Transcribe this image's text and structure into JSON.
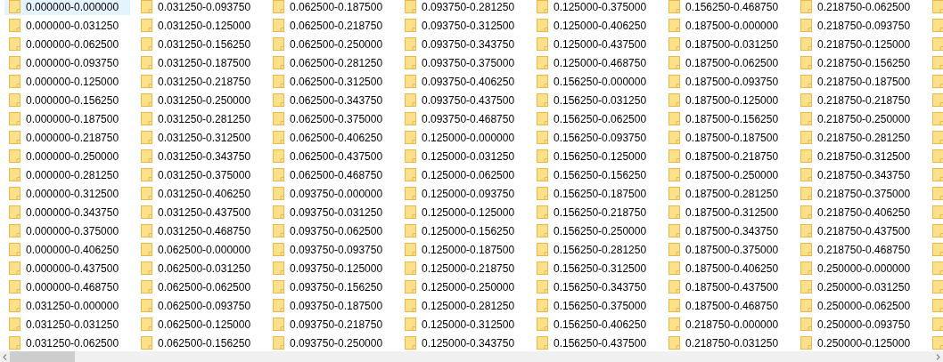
{
  "items": [
    {
      "name": "0.000000-0.000000",
      "selected": true
    },
    {
      "name": "0.000000-0.031250",
      "selected": false
    },
    {
      "name": "0.000000-0.062500",
      "selected": false
    },
    {
      "name": "0.000000-0.093750",
      "selected": false
    },
    {
      "name": "0.000000-0.125000",
      "selected": false
    },
    {
      "name": "0.000000-0.156250",
      "selected": false
    },
    {
      "name": "0.000000-0.187500",
      "selected": false
    },
    {
      "name": "0.000000-0.218750",
      "selected": false
    },
    {
      "name": "0.000000-0.250000",
      "selected": false
    },
    {
      "name": "0.000000-0.281250",
      "selected": false
    },
    {
      "name": "0.000000-0.312500",
      "selected": false
    },
    {
      "name": "0.000000-0.343750",
      "selected": false
    },
    {
      "name": "0.000000-0.375000",
      "selected": false
    },
    {
      "name": "0.000000-0.406250",
      "selected": false
    },
    {
      "name": "0.000000-0.437500",
      "selected": false
    },
    {
      "name": "0.000000-0.468750",
      "selected": false
    },
    {
      "name": "0.031250-0.000000",
      "selected": false
    },
    {
      "name": "0.031250-0.031250",
      "selected": false
    },
    {
      "name": "0.031250-0.062500",
      "selected": false
    },
    {
      "name": "0.031250-0.093750",
      "selected": false
    },
    {
      "name": "0.031250-0.125000",
      "selected": false
    },
    {
      "name": "0.031250-0.156250",
      "selected": false
    },
    {
      "name": "0.031250-0.187500",
      "selected": false
    },
    {
      "name": "0.031250-0.218750",
      "selected": false
    },
    {
      "name": "0.031250-0.250000",
      "selected": false
    },
    {
      "name": "0.031250-0.281250",
      "selected": false
    },
    {
      "name": "0.031250-0.312500",
      "selected": false
    },
    {
      "name": "0.031250-0.343750",
      "selected": false
    },
    {
      "name": "0.031250-0.375000",
      "selected": false
    },
    {
      "name": "0.031250-0.406250",
      "selected": false
    },
    {
      "name": "0.031250-0.437500",
      "selected": false
    },
    {
      "name": "0.031250-0.468750",
      "selected": false
    },
    {
      "name": "0.062500-0.000000",
      "selected": false
    },
    {
      "name": "0.062500-0.031250",
      "selected": false
    },
    {
      "name": "0.062500-0.062500",
      "selected": false
    },
    {
      "name": "0.062500-0.093750",
      "selected": false
    },
    {
      "name": "0.062500-0.125000",
      "selected": false
    },
    {
      "name": "0.062500-0.156250",
      "selected": false
    },
    {
      "name": "0.062500-0.187500",
      "selected": false
    },
    {
      "name": "0.062500-0.218750",
      "selected": false
    },
    {
      "name": "0.062500-0.250000",
      "selected": false
    },
    {
      "name": "0.062500-0.281250",
      "selected": false
    },
    {
      "name": "0.062500-0.312500",
      "selected": false
    },
    {
      "name": "0.062500-0.343750",
      "selected": false
    },
    {
      "name": "0.062500-0.375000",
      "selected": false
    },
    {
      "name": "0.062500-0.406250",
      "selected": false
    },
    {
      "name": "0.062500-0.437500",
      "selected": false
    },
    {
      "name": "0.062500-0.468750",
      "selected": false
    },
    {
      "name": "0.093750-0.000000",
      "selected": false
    },
    {
      "name": "0.093750-0.031250",
      "selected": false
    },
    {
      "name": "0.093750-0.062500",
      "selected": false
    },
    {
      "name": "0.093750-0.093750",
      "selected": false
    },
    {
      "name": "0.093750-0.125000",
      "selected": false
    },
    {
      "name": "0.093750-0.156250",
      "selected": false
    },
    {
      "name": "0.093750-0.187500",
      "selected": false
    },
    {
      "name": "0.093750-0.218750",
      "selected": false
    },
    {
      "name": "0.093750-0.250000",
      "selected": false
    },
    {
      "name": "0.093750-0.281250",
      "selected": false
    },
    {
      "name": "0.093750-0.312500",
      "selected": false
    },
    {
      "name": "0.093750-0.343750",
      "selected": false
    },
    {
      "name": "0.093750-0.375000",
      "selected": false
    },
    {
      "name": "0.093750-0.406250",
      "selected": false
    },
    {
      "name": "0.093750-0.437500",
      "selected": false
    },
    {
      "name": "0.093750-0.468750",
      "selected": false
    },
    {
      "name": "0.125000-0.000000",
      "selected": false
    },
    {
      "name": "0.125000-0.031250",
      "selected": false
    },
    {
      "name": "0.125000-0.062500",
      "selected": false
    },
    {
      "name": "0.125000-0.093750",
      "selected": false
    },
    {
      "name": "0.125000-0.125000",
      "selected": false
    },
    {
      "name": "0.125000-0.156250",
      "selected": false
    },
    {
      "name": "0.125000-0.187500",
      "selected": false
    },
    {
      "name": "0.125000-0.218750",
      "selected": false
    },
    {
      "name": "0.125000-0.250000",
      "selected": false
    },
    {
      "name": "0.125000-0.281250",
      "selected": false
    },
    {
      "name": "0.125000-0.312500",
      "selected": false
    },
    {
      "name": "0.125000-0.343750",
      "selected": false
    },
    {
      "name": "0.125000-0.375000",
      "selected": false
    },
    {
      "name": "0.125000-0.406250",
      "selected": false
    },
    {
      "name": "0.125000-0.437500",
      "selected": false
    },
    {
      "name": "0.125000-0.468750",
      "selected": false
    },
    {
      "name": "0.156250-0.000000",
      "selected": false
    },
    {
      "name": "0.156250-0.031250",
      "selected": false
    },
    {
      "name": "0.156250-0.062500",
      "selected": false
    },
    {
      "name": "0.156250-0.093750",
      "selected": false
    },
    {
      "name": "0.156250-0.125000",
      "selected": false
    },
    {
      "name": "0.156250-0.156250",
      "selected": false
    },
    {
      "name": "0.156250-0.187500",
      "selected": false
    },
    {
      "name": "0.156250-0.218750",
      "selected": false
    },
    {
      "name": "0.156250-0.250000",
      "selected": false
    },
    {
      "name": "0.156250-0.281250",
      "selected": false
    },
    {
      "name": "0.156250-0.312500",
      "selected": false
    },
    {
      "name": "0.156250-0.343750",
      "selected": false
    },
    {
      "name": "0.156250-0.375000",
      "selected": false
    },
    {
      "name": "0.156250-0.406250",
      "selected": false
    },
    {
      "name": "0.156250-0.437500",
      "selected": false
    },
    {
      "name": "0.156250-0.468750",
      "selected": false
    },
    {
      "name": "0.187500-0.000000",
      "selected": false
    },
    {
      "name": "0.187500-0.031250",
      "selected": false
    },
    {
      "name": "0.187500-0.062500",
      "selected": false
    },
    {
      "name": "0.187500-0.093750",
      "selected": false
    },
    {
      "name": "0.187500-0.125000",
      "selected": false
    },
    {
      "name": "0.187500-0.156250",
      "selected": false
    },
    {
      "name": "0.187500-0.187500",
      "selected": false
    },
    {
      "name": "0.187500-0.218750",
      "selected": false
    },
    {
      "name": "0.187500-0.250000",
      "selected": false
    },
    {
      "name": "0.187500-0.281250",
      "selected": false
    },
    {
      "name": "0.187500-0.312500",
      "selected": false
    },
    {
      "name": "0.187500-0.343750",
      "selected": false
    },
    {
      "name": "0.187500-0.375000",
      "selected": false
    },
    {
      "name": "0.187500-0.406250",
      "selected": false
    },
    {
      "name": "0.187500-0.437500",
      "selected": false
    },
    {
      "name": "0.187500-0.468750",
      "selected": false
    },
    {
      "name": "0.218750-0.000000",
      "selected": false
    },
    {
      "name": "0.218750-0.031250",
      "selected": false
    },
    {
      "name": "0.218750-0.062500",
      "selected": false
    },
    {
      "name": "0.218750-0.093750",
      "selected": false
    },
    {
      "name": "0.218750-0.125000",
      "selected": false
    },
    {
      "name": "0.218750-0.156250",
      "selected": false
    },
    {
      "name": "0.218750-0.187500",
      "selected": false
    },
    {
      "name": "0.218750-0.218750",
      "selected": false
    },
    {
      "name": "0.218750-0.250000",
      "selected": false
    },
    {
      "name": "0.218750-0.281250",
      "selected": false
    },
    {
      "name": "0.218750-0.312500",
      "selected": false
    },
    {
      "name": "0.218750-0.343750",
      "selected": false
    },
    {
      "name": "0.218750-0.375000",
      "selected": false
    },
    {
      "name": "0.218750-0.406250",
      "selected": false
    },
    {
      "name": "0.218750-0.437500",
      "selected": false
    },
    {
      "name": "0.218750-0.468750",
      "selected": false
    },
    {
      "name": "0.250000-0.000000",
      "selected": false
    },
    {
      "name": "0.250000-0.031250",
      "selected": false
    },
    {
      "name": "0.250000-0.062500",
      "selected": false
    },
    {
      "name": "0.250000-0.093750",
      "selected": false
    },
    {
      "name": "0.250000-0.125000",
      "selected": false
    }
  ],
  "cut_off_items": [
    {
      "kind": "folder"
    },
    {
      "kind": "folder"
    },
    {
      "kind": "folder"
    },
    {
      "kind": "folder"
    },
    {
      "kind": "folder"
    },
    {
      "kind": "folder"
    },
    {
      "kind": "folder"
    },
    {
      "kind": "folder"
    },
    {
      "kind": "folder"
    },
    {
      "kind": "folder"
    },
    {
      "kind": "folder"
    },
    {
      "kind": "folder"
    },
    {
      "kind": "folder"
    },
    {
      "kind": "folder"
    },
    {
      "kind": "folder"
    },
    {
      "kind": "folder"
    },
    {
      "kind": "folder"
    },
    {
      "kind": "folder"
    },
    {
      "kind": "folder"
    }
  ]
}
